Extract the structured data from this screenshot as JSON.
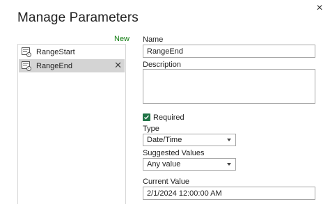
{
  "dialog": {
    "title": "Manage Parameters",
    "close_glyph": "×"
  },
  "list": {
    "new_label": "New",
    "items": [
      {
        "label": "RangeStart",
        "icon": "parameter-icon"
      },
      {
        "label": "RangeEnd",
        "icon": "parameter-icon",
        "selected": true
      }
    ],
    "remove_glyph": "✕"
  },
  "form": {
    "name_label": "Name",
    "name_value": "RangeEnd",
    "description_label": "Description",
    "description_value": "",
    "required_label": "Required",
    "required_checked": true,
    "type_label": "Type",
    "type_value": "Date/Time",
    "suggested_label": "Suggested Values",
    "suggested_value": "Any value",
    "current_label": "Current Value",
    "current_value": "2/1/2024 12:00:00 AM"
  },
  "colors": {
    "accent_green": "#217346",
    "new_link": "#107c10",
    "selected_row": "#d4d4d4"
  }
}
